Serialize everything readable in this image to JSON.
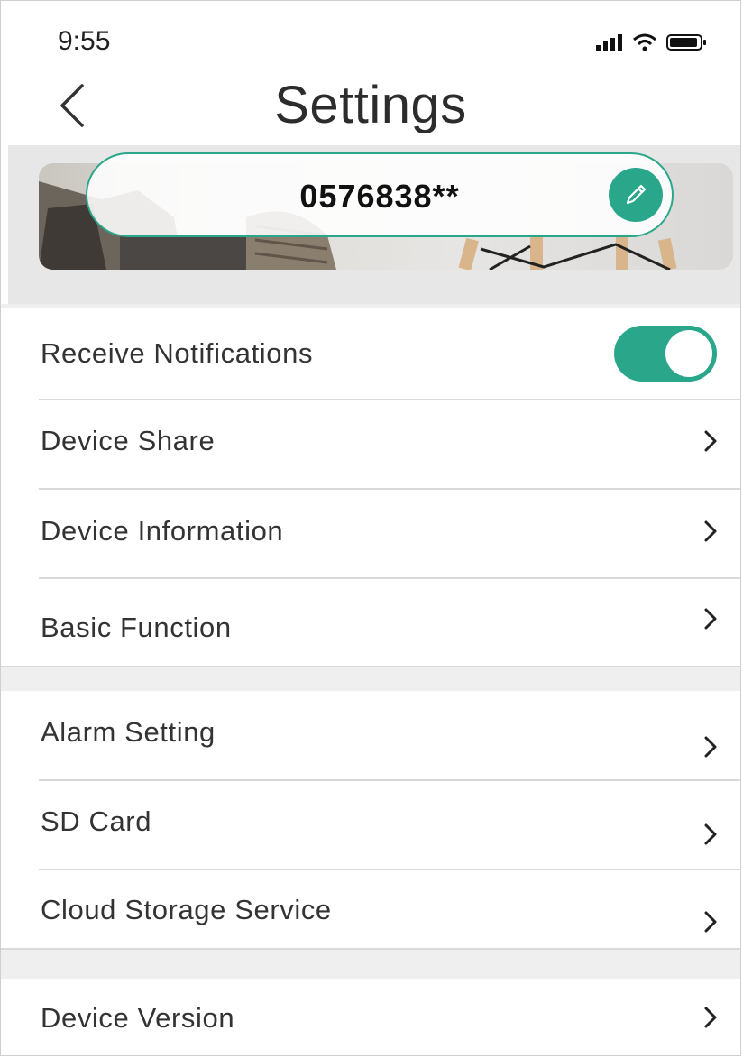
{
  "status_bar": {
    "time": "9:55",
    "icons": [
      "signal-icon",
      "wifi-icon",
      "battery-icon"
    ]
  },
  "header": {
    "title": "Settings",
    "back_icon": "chevron-left-icon"
  },
  "device": {
    "name": "0576838**",
    "edit_icon": "pencil-icon"
  },
  "colors": {
    "accent": "#2aa78a",
    "separator": "#efefef"
  },
  "settings": {
    "receive_notifications": {
      "label": "Receive Notifications",
      "enabled": true
    },
    "device_share": {
      "label": "Device Share"
    },
    "device_information": {
      "label": "Device Information"
    },
    "basic_function": {
      "label": "Basic Function"
    },
    "alarm_setting": {
      "label": "Alarm Setting"
    },
    "sd_card": {
      "label": "SD Card"
    },
    "cloud_storage_service": {
      "label": "Cloud Storage Service"
    },
    "device_version": {
      "label": "Device Version"
    }
  }
}
